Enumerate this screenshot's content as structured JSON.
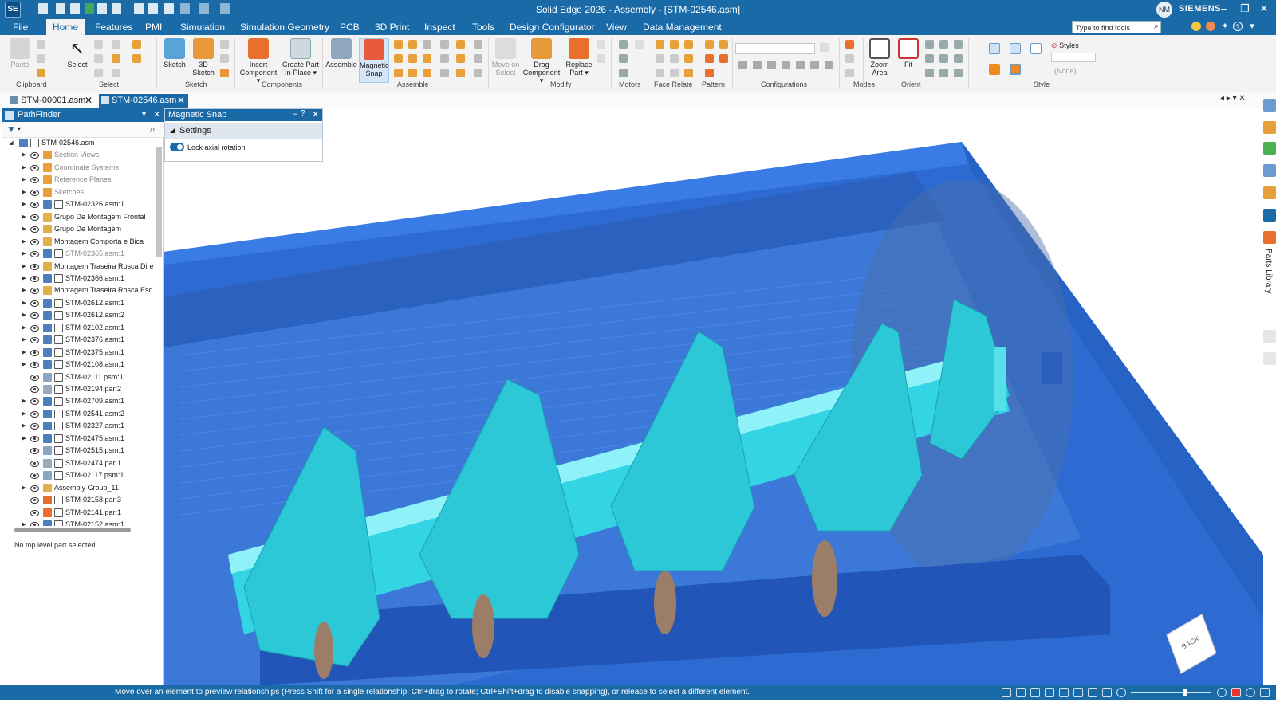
{
  "app": {
    "logo": "SE",
    "title": "Solid Edge 2026 - Assembly - [STM-02546.asm]",
    "user_initials": "NM",
    "brand": "SIEMENS",
    "window_controls": [
      "–",
      "❐",
      "▭",
      "✕"
    ]
  },
  "menu": {
    "tabs": [
      "File",
      "Home",
      "Features",
      "PMI",
      "Simulation",
      "Simulation Geometry",
      "PCB",
      "3D Print",
      "Inspect",
      "Tools",
      "Design Configurator",
      "View",
      "Data Management"
    ],
    "active_tab": "Home",
    "search_placeholder": "Type to find tools"
  },
  "ribbon": {
    "buttons": {
      "paste": "Paste",
      "select": "Select",
      "sketch": "Sketch",
      "sketch3d_1": "3D",
      "sketch3d_2": "Sketch",
      "insert_1": "Insert",
      "insert_2": "Component ▾",
      "createpart_1": "Create Part",
      "createpart_2": "In-Place ▾",
      "assemble": "Assemble",
      "magnetic_1": "Magnetic",
      "magnetic_2": "Snap",
      "move_1": "Move on",
      "move_2": "Select",
      "drag_1": "Drag",
      "drag_2": "Component ▾",
      "replace_1": "Replace",
      "replace_2": "Part ▾",
      "zoom_1": "Zoom",
      "zoom_2": "Area",
      "fit": "Fit"
    },
    "groups": [
      "Clipboard",
      "Select",
      "Sketch",
      "Components",
      "Assemble",
      "Modify",
      "Motors",
      "Face Relate",
      "Pattern",
      "Configurations",
      "Modes",
      "Orient",
      "Style"
    ],
    "style_label": "Styles",
    "style_value": "(None)"
  },
  "doc_tabs": [
    {
      "name": "STM-00001.asm"
    },
    {
      "name": "STM-02546.asm",
      "active": true
    }
  ],
  "pathfinder": {
    "title": "PathFinder",
    "root": "STM-02546.asm",
    "items": [
      {
        "label": "Section Views",
        "dim": true,
        "type": "folder"
      },
      {
        "label": "Coordinate Systems",
        "dim": true,
        "type": "folder"
      },
      {
        "label": "Reference Planes",
        "dim": true,
        "type": "folder"
      },
      {
        "label": "Sketches",
        "dim": true,
        "type": "folder"
      },
      {
        "label": "STM-02326.asm:1",
        "type": "asm"
      },
      {
        "label": "Grupo De Montagem Frontal",
        "type": "group"
      },
      {
        "label": "Grupo De Montagem",
        "type": "group"
      },
      {
        "label": "Montagem Comporta e Bica",
        "type": "group"
      },
      {
        "label": "STM-02365.asm:1",
        "dim": true,
        "type": "asm"
      },
      {
        "label": "Montagem Traseira Rosca Direita",
        "type": "group"
      },
      {
        "label": "STM-02366.asm:1",
        "type": "asm"
      },
      {
        "label": "Montagem Traseira Rosca Esque",
        "type": "group"
      },
      {
        "label": "STM-02612.asm:1",
        "type": "asm"
      },
      {
        "label": "STM-02612.asm:2",
        "type": "asm"
      },
      {
        "label": "STM-02102.asm:1",
        "type": "asm"
      },
      {
        "label": "STM-02376.asm:1",
        "type": "asm"
      },
      {
        "label": "STM-02375.asm:1",
        "type": "asm"
      },
      {
        "label": "STM-02108.asm:1",
        "type": "asm"
      },
      {
        "label": "STM-02111.psm:1",
        "type": "psm"
      },
      {
        "label": "STM-02194.par:2",
        "type": "par"
      },
      {
        "label": "STM-02709.asm:1",
        "type": "asm"
      },
      {
        "label": "STM-02541.asm:2",
        "type": "asm"
      },
      {
        "label": "STM-02327.asm:1",
        "type": "asm"
      },
      {
        "label": "STM-02475.asm:1",
        "type": "asm"
      },
      {
        "label": "STM-02515.psm:1",
        "type": "psm"
      },
      {
        "label": "STM-02474.par:1",
        "type": "par"
      },
      {
        "label": "STM-02117.psm:1",
        "type": "psm"
      },
      {
        "label": "Assembly Group_11",
        "type": "group"
      },
      {
        "label": "STM-02158.par:3",
        "type": "parorange"
      },
      {
        "label": "STM-02141.par:1",
        "type": "parorange"
      },
      {
        "label": "STM-02152.asm:1",
        "type": "asm"
      }
    ],
    "status": "No top level part selected."
  },
  "magnetic_snap": {
    "title": "Magnetic Snap",
    "section": "Settings",
    "toggle_label": "Lock axial rotation",
    "toggle_on": true
  },
  "right_strip": {
    "parts_library": "Parts Library"
  },
  "viewcube": {
    "face": "BACK"
  },
  "status_bar": {
    "message": "Move over an element to preview relationships (Press Shift for a single relationship; Ctrl+drag to rotate; Ctrl+Shift+drag to disable snapping), or release to select a different element."
  },
  "colors": {
    "accent": "#1a6aa8",
    "housing": "#2f6fd6",
    "auger": "#2ed0e0"
  }
}
